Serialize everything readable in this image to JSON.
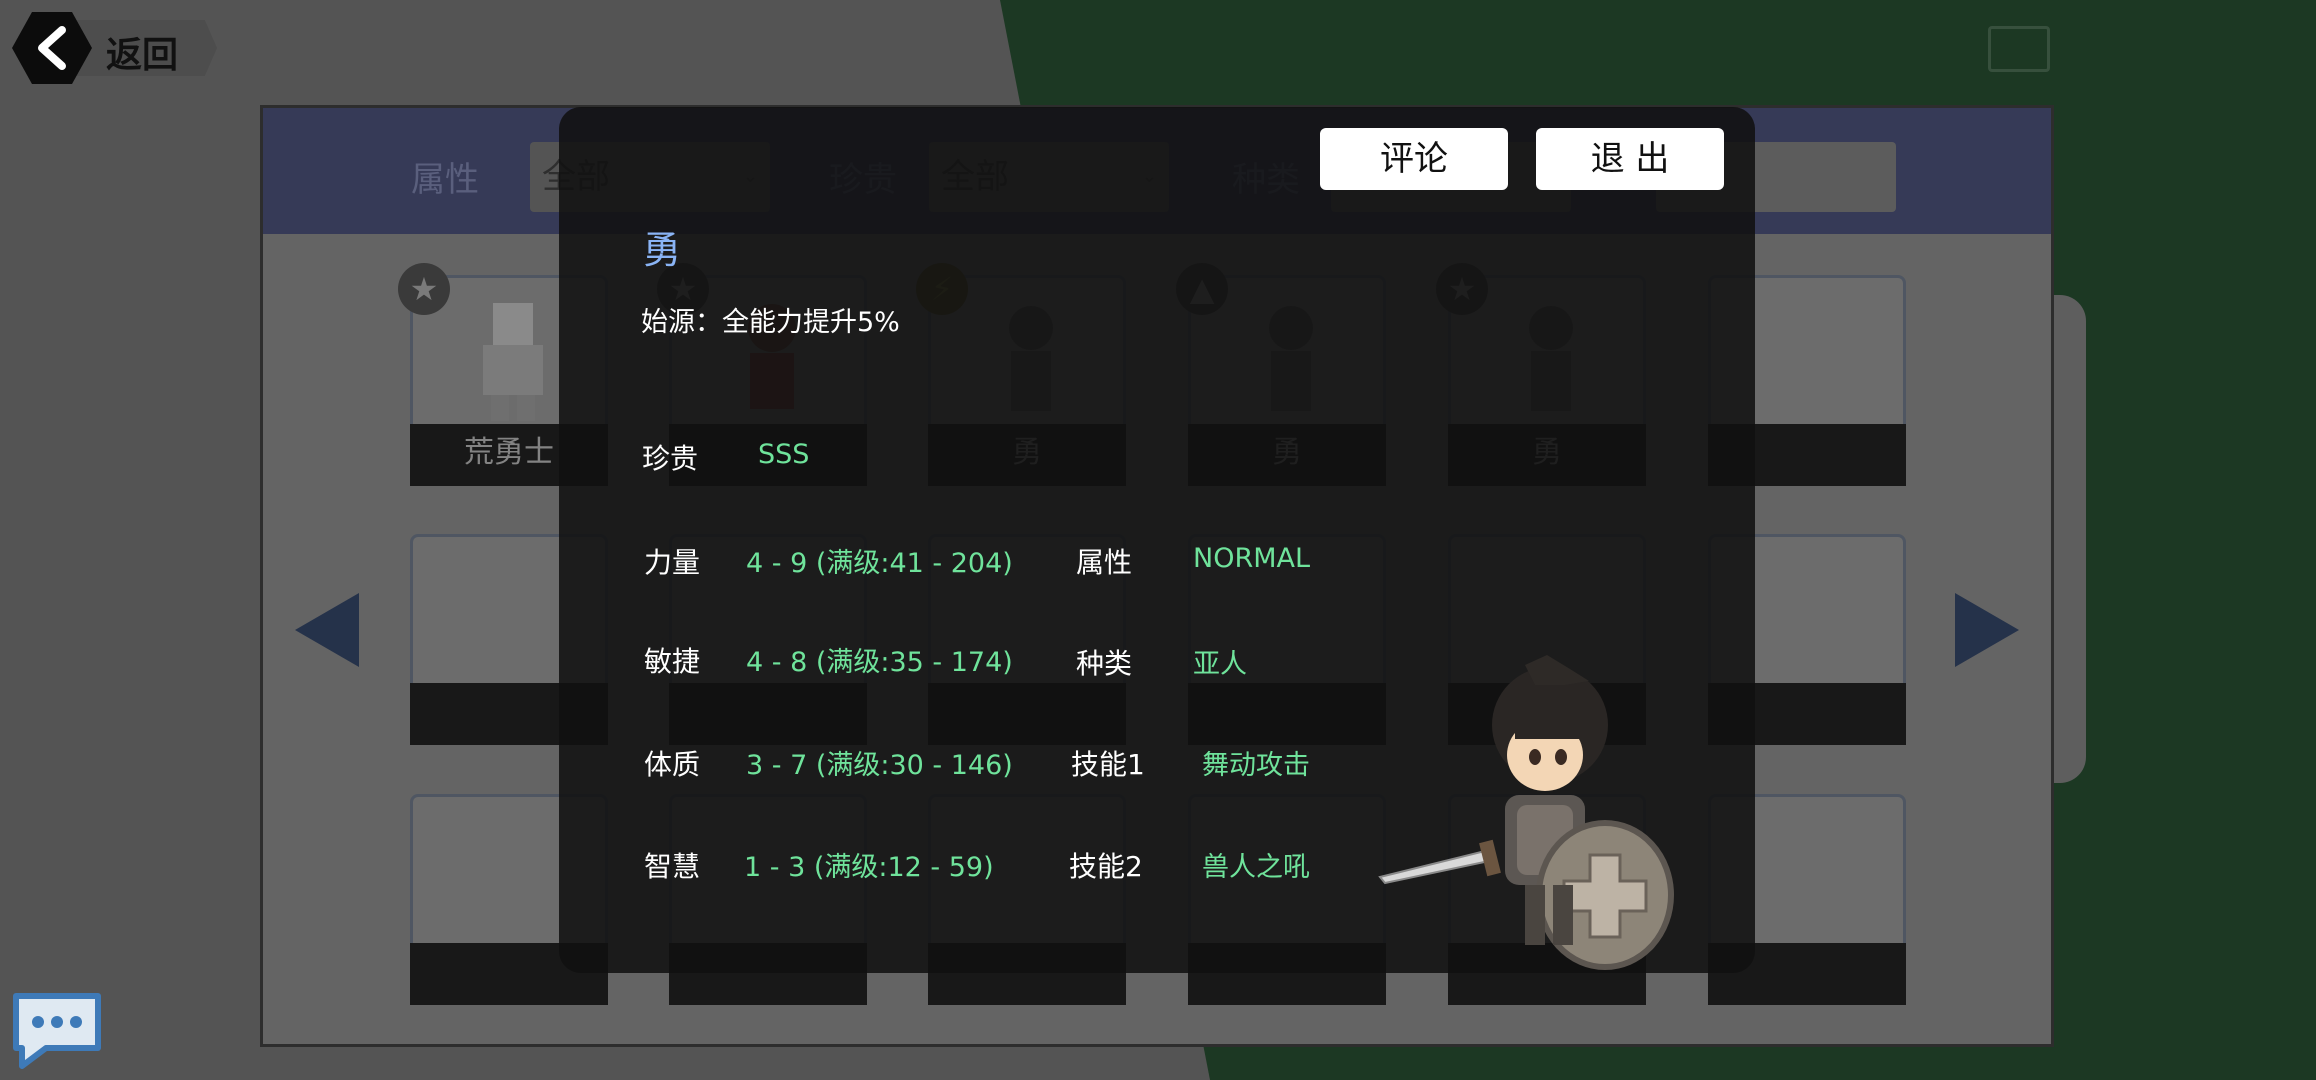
{
  "nav": {
    "back_label": "返回"
  },
  "filters": [
    {
      "label": "属性",
      "value": "全部"
    },
    {
      "label": "珍贵",
      "value": "全部"
    },
    {
      "label": "种类",
      "value": ""
    }
  ],
  "grid": {
    "cards": [
      {
        "name": "荒勇士",
        "badge": "star-icon"
      },
      {
        "name": "",
        "badge": "star-icon"
      },
      {
        "name": "勇",
        "badge": "lightning-icon"
      },
      {
        "name": "勇",
        "badge": "triangle-icon"
      },
      {
        "name": "勇",
        "badge": "star-icon"
      },
      {
        "name": ""
      },
      {
        "name": ""
      },
      {
        "name": ""
      },
      {
        "name": ""
      },
      {
        "name": ""
      },
      {
        "name": ""
      },
      {
        "name": ""
      },
      {
        "name": ""
      },
      {
        "name": ""
      },
      {
        "name": ""
      },
      {
        "name": ""
      },
      {
        "name": ""
      },
      {
        "name": ""
      }
    ]
  },
  "modal": {
    "comment_button": "评论",
    "exit_button": "退 出",
    "title": "勇",
    "origin_label": "始源：",
    "origin_value": "全能力提升5%",
    "rarity_label": "珍贵",
    "rarity_value": "SSS",
    "stats": [
      {
        "label": "力量",
        "value": "4 - 9 (满级:41 - 204)"
      },
      {
        "label": "敏捷",
        "value": "4 - 8 (满级:35 - 174)"
      },
      {
        "label": "体质",
        "value": "3 - 7 (满级:30 - 146)"
      },
      {
        "label": "智慧",
        "value": "1 - 3 (满级:12 - 59)"
      }
    ],
    "info": [
      {
        "label": "属性",
        "value": "NORMAL"
      },
      {
        "label": "种类",
        "value": "亚人"
      },
      {
        "label": "技能1",
        "value": "舞动攻击"
      },
      {
        "label": "技能2",
        "value": "兽人之吼"
      }
    ]
  },
  "colors": {
    "value_green": "#6fe39b",
    "title_blue": "#8ab4f5",
    "header_navy": "#363a57",
    "arrow_navy": "#25324a"
  },
  "icons": {
    "back": "chevron-left-icon",
    "chat": "speech-bubble-icon",
    "prev": "triangle-left-icon",
    "next": "triangle-right-icon"
  }
}
